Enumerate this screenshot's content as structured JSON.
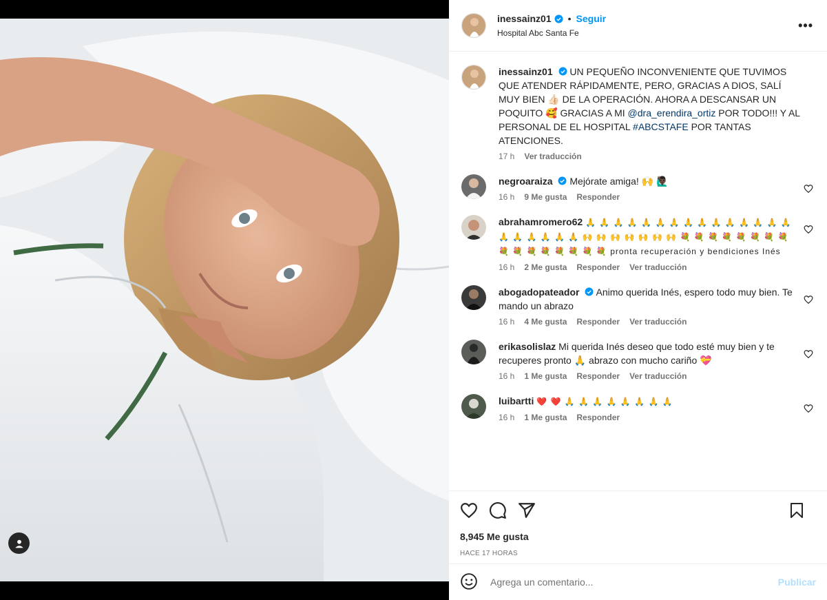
{
  "post": {
    "username": "inessainz01",
    "follow_label": "Seguir",
    "separator": "•",
    "location": "Hospital Abc Santa Fe",
    "more_label": "•••",
    "caption_part1": "UN PEQUEÑO INCONVENIENTE QUE TUVIMOS QUE ATENDER RÁPIDAMENTE, PERO, GRACIAS A DIOS, SALÍ MUY BIEN 👍🏻 DE LA OPERACIÓN. AHORA A DESCANSAR UN POQUITO 🥰 GRACIAS A MI ",
    "caption_mention": "@dra_erendira_ortiz",
    "caption_part2": " POR TODO!!! Y AL PERSONAL DE EL HOSPITAL ",
    "caption_hashtag": "#ABCSTAFE",
    "caption_part3": " POR TANTAS ATENCIONES.",
    "caption_time": "17 h",
    "see_translation": "Ver traducción"
  },
  "comments": [
    {
      "user": "negroaraiza",
      "verified": true,
      "text": "Mejórate amiga! 🙌 🙋🏿‍♂️",
      "time": "16 h",
      "likes": "9 Me gusta",
      "reply": "Responder",
      "translate": ""
    },
    {
      "user": "abrahamromero62",
      "verified": false,
      "text": "🙏 🙏 🙏 🙏 🙏 🙏 🙏 🙏 🙏 🙏 🙏 🙏 🙏 🙏 🙏 🙏 🙏 🙏 🙏 🙏 🙏 🙌 🙌 🙌 🙌 🙌 🙌 🙌 💐 💐 💐 💐 💐 💐 💐 💐 💐 💐 💐 💐 💐 💐 💐 💐 pronta recuperación y bendiciones Inés",
      "time": "16 h",
      "likes": "2 Me gusta",
      "reply": "Responder",
      "translate": "Ver traducción"
    },
    {
      "user": "abogadopateador",
      "verified": true,
      "text": "Animo querida Inés, espero todo muy bien. Te mando un abrazo",
      "time": "16 h",
      "likes": "4 Me gusta",
      "reply": "Responder",
      "translate": "Ver traducción"
    },
    {
      "user": "erikasolislaz",
      "verified": false,
      "text": "Mi querida Inés deseo que todo esté muy bien y te recuperes pronto 🙏 abrazo con mucho cariño 💝",
      "time": "16 h",
      "likes": "1 Me gusta",
      "reply": "Responder",
      "translate": "Ver traducción"
    },
    {
      "user": "luibartti",
      "verified": false,
      "text": "❤️ ❤️ 🙏 🙏 🙏 🙏 🙏 🙏 🙏 🙏",
      "time": "16 h",
      "likes": "1 Me gusta",
      "reply": "Responder",
      "translate": ""
    }
  ],
  "actions": {
    "likes_count": "8,945 Me gusta",
    "posted_ago": "HACE 17 HORAS",
    "comment_placeholder": "Agrega un comentario...",
    "publish_label": "Publicar"
  },
  "icons": [
    "heart-icon",
    "comment-icon",
    "share-icon",
    "save-icon",
    "emoji-icon",
    "user-tag-icon",
    "verified-icon",
    "more-icon"
  ],
  "colors": {
    "accent": "#0095f6",
    "link": "#00376b",
    "muted": "#737373",
    "publish_disabled": "#b2dffc",
    "verified": "#0095f6"
  }
}
